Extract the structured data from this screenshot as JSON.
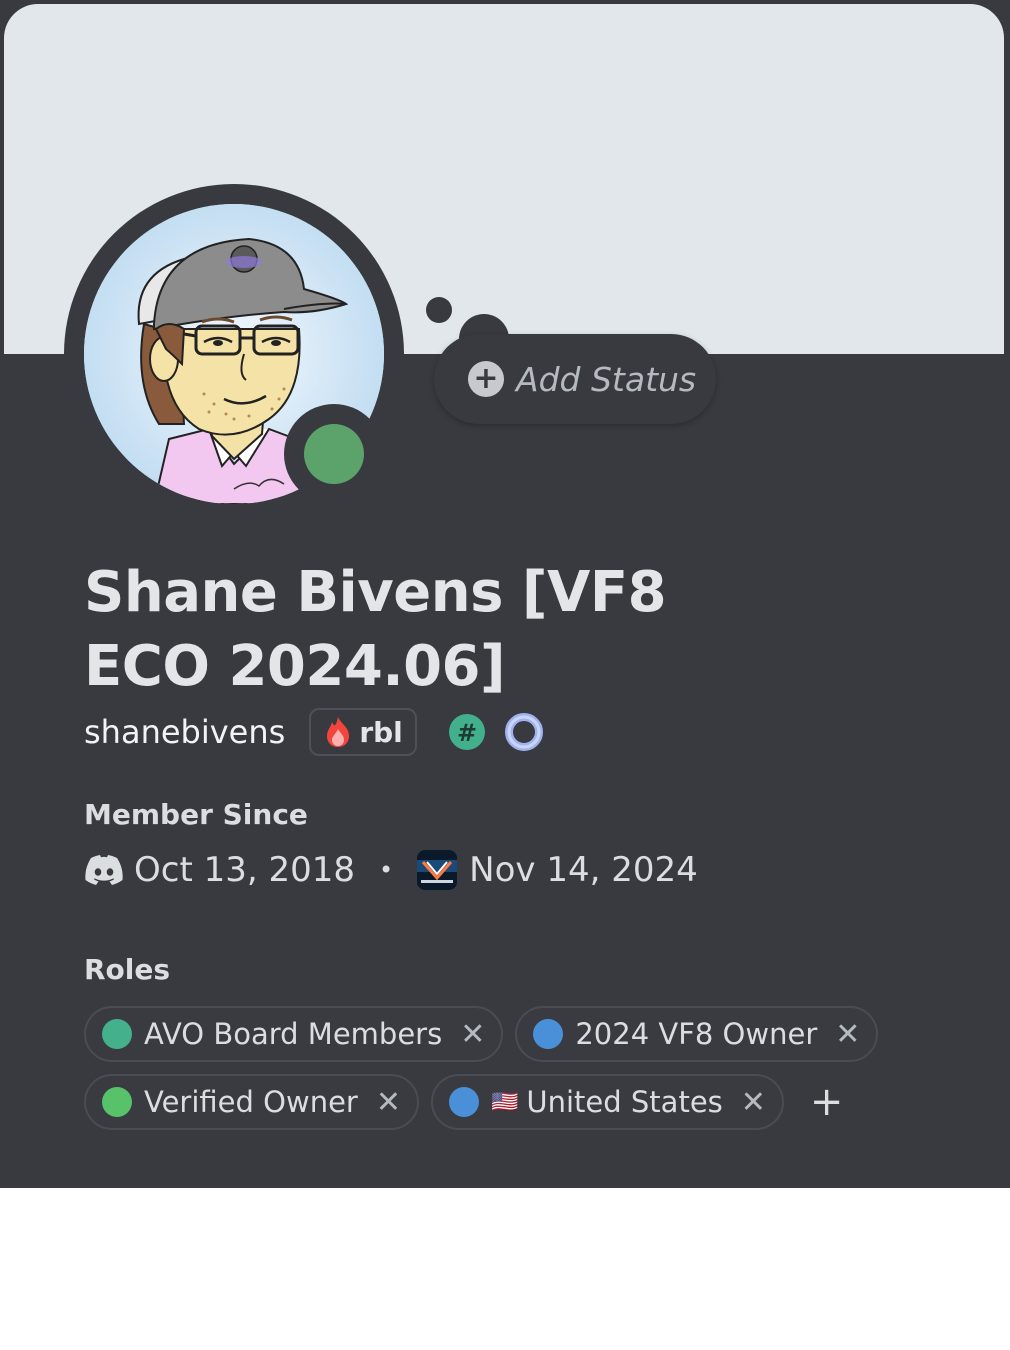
{
  "profile": {
    "display_name": "Shane Bivens [VF8 ECO 2024.06]",
    "username": "shanebivens",
    "tag": "rbl",
    "status_action": "Add Status",
    "online_color": "#5ba36b"
  },
  "member_since": {
    "title": "Member Since",
    "discord_date": "Oct 13, 2018",
    "separator": "•",
    "server_date": "Nov 14, 2024"
  },
  "roles": {
    "title": "Roles",
    "items": [
      {
        "name": "AVO Board Members",
        "color": "#45b08c"
      },
      {
        "name": "2024 VF8 Owner",
        "color": "#4a90d9"
      },
      {
        "name": "Verified Owner",
        "color": "#57c26a"
      },
      {
        "name": "United States",
        "color": "#4a90d9",
        "flag": "🇺🇸"
      }
    ],
    "remove_symbol": "✕",
    "add_symbol": "+"
  }
}
